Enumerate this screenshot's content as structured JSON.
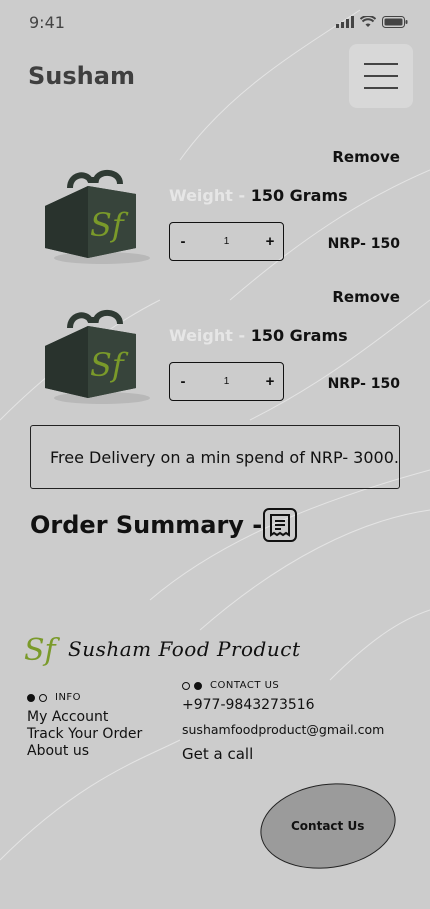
{
  "status_bar": {
    "time": "9:41"
  },
  "header": {
    "brand": "Susham"
  },
  "cart": {
    "items": [
      {
        "remove_label": "Remove",
        "weight_label": "Weight - ",
        "weight_value": "150 Grams",
        "qty_minus": "-",
        "qty": "1",
        "qty_plus": "+",
        "price": "NRP- 150"
      },
      {
        "remove_label": "Remove",
        "weight_label": "Weight - ",
        "weight_value": "150 Grams",
        "qty_minus": "-",
        "qty": "1",
        "qty_plus": "+",
        "price": "NRP- 150"
      }
    ]
  },
  "delivery_notice": "Free Delivery on a min spend of NRP- 3000.",
  "order_summary": {
    "title": "Order Summary -",
    "icon": "receipt-icon"
  },
  "footer": {
    "logo_text": "Susham Food Product",
    "info": {
      "heading": "INFO",
      "links": [
        "My Account",
        "Track Your Order",
        "About us"
      ]
    },
    "contact": {
      "heading": "CONTACT US",
      "phone": "+977-9843273516",
      "email": "sushamfoodproduct@gmail.com",
      "call_label": "Get a call",
      "button_label": "Contact Us"
    }
  },
  "colors": {
    "background": "#cccccc",
    "product_box": "#2f3a33",
    "logo_green": "#7a9a2a",
    "button_fill": "#9b9b9b"
  }
}
